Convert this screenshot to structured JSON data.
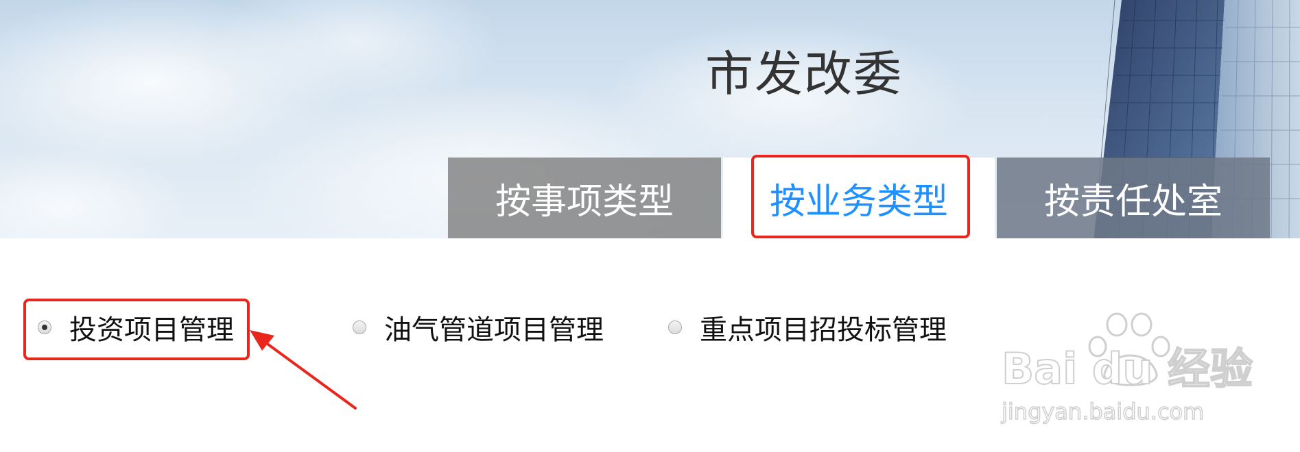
{
  "header": {
    "title": "市发改委"
  },
  "tabs": [
    {
      "label": "按事项类型",
      "active": false
    },
    {
      "label": "按业务类型",
      "active": true
    },
    {
      "label": "按责任处室",
      "active": false
    }
  ],
  "options": [
    {
      "label": "投资项目管理",
      "checked": true
    },
    {
      "label": "油气管道项目管理",
      "checked": false
    },
    {
      "label": "重点项目招投标管理",
      "checked": false
    }
  ],
  "watermark": {
    "brand": "Bai du 经验",
    "url": "jingyan.baidu.com"
  },
  "colors": {
    "active_tab_text": "#1e90ff",
    "highlight_border": "#e8261c",
    "inactive_tab_bg": "#808080"
  }
}
